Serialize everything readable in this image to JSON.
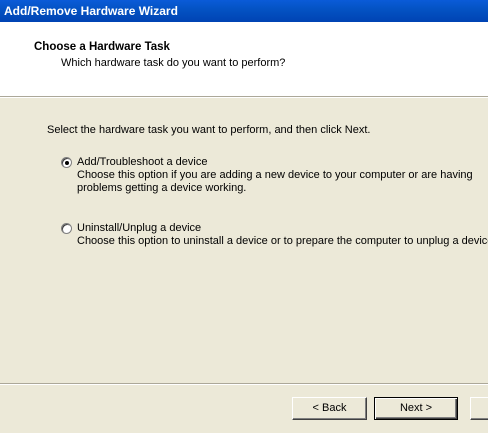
{
  "window": {
    "title": "Add/Remove Hardware Wizard"
  },
  "header": {
    "title": "Choose a Hardware Task",
    "subtitle": "Which hardware task do you want to perform?"
  },
  "main": {
    "instruction": "Select the hardware task you want to perform, and then click Next.",
    "options": [
      {
        "label": "Add/Troubleshoot a device",
        "description": "Choose this option if you are adding a new device to your computer or are having problems getting a device working.",
        "selected": true
      },
      {
        "label": "Uninstall/Unplug a device",
        "description": "Choose this option to uninstall a device or to prepare the computer to unplug a device.",
        "selected": false
      }
    ]
  },
  "buttons": {
    "back_label": "< Back",
    "next_label": "Next >",
    "cancel_label": ""
  }
}
